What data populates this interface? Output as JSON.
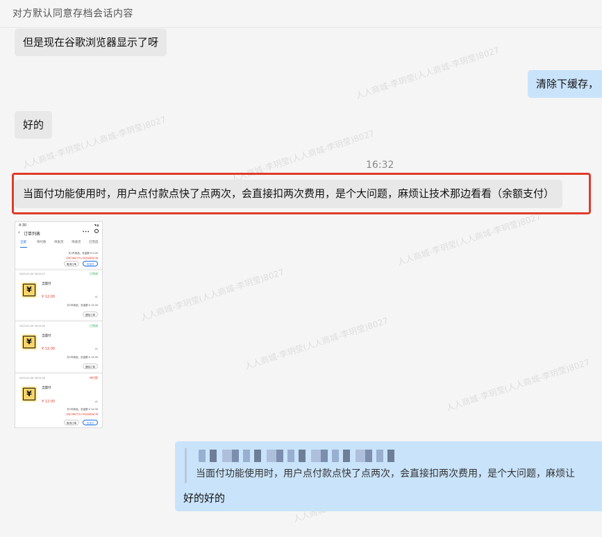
{
  "header": {
    "title": "对方默认同意存档会话内容"
  },
  "messages": {
    "m1": "但是现在谷歌浏览器显示了呀",
    "m2": "清除下缓存，",
    "m3": "好的",
    "timestamp": "16:32",
    "m4": "当面付功能使用时，用户点付款点快了点两次，会直接扣两次费用，是个大问题，麻烦让技术那边看看（余额支付）"
  },
  "phone": {
    "time": "4:30",
    "title": "订单列表",
    "tabs": [
      "全部",
      "待付款",
      "待发货",
      "待收货",
      "已完成"
    ],
    "first_summary": "共1件商品，总金额 ¥ 0.00",
    "first_warning": "该笔订单将于约12时自动取消订单",
    "cancel_label": "取消订单",
    "pay_label": "去支付",
    "delete_label": "删除订单",
    "orders": [
      {
        "date": "2023-02-09 16:24:27",
        "status": "已完成",
        "status_color": "#1fae4b",
        "name": "当面付",
        "price": "¥ 12.00",
        "qty": "x1",
        "summary": "共1件商品，总金额 ¥ 12.00",
        "action": "删除订单"
      },
      {
        "date": "2023-02-09 16:24:25",
        "status": "已完成",
        "status_color": "#1fae4b",
        "name": "当面付",
        "price": "¥ 12.00",
        "qty": "x1",
        "summary": "共1件商品，总金额 ¥ 12.00",
        "action": "删除订单"
      },
      {
        "date": "2023-02-09 16:24:20",
        "status": "待付款",
        "status_color": "#e43b2b",
        "name": "当面付",
        "price": "¥ 12.00",
        "qty": "x1",
        "summary": "共1件商品，总金额 ¥ 12.00",
        "warning": "该笔订单将于约12时自动取消订单"
      }
    ]
  },
  "reply": {
    "quote_text": "当面付功能使用时，用户点付款点快了点两次，会直接扣两次费用，是个大问题，麻烦让",
    "text": "好的好的"
  },
  "watermark": {
    "text": "人人商城-李玥莹(人人商城-李玥莹)8027"
  }
}
